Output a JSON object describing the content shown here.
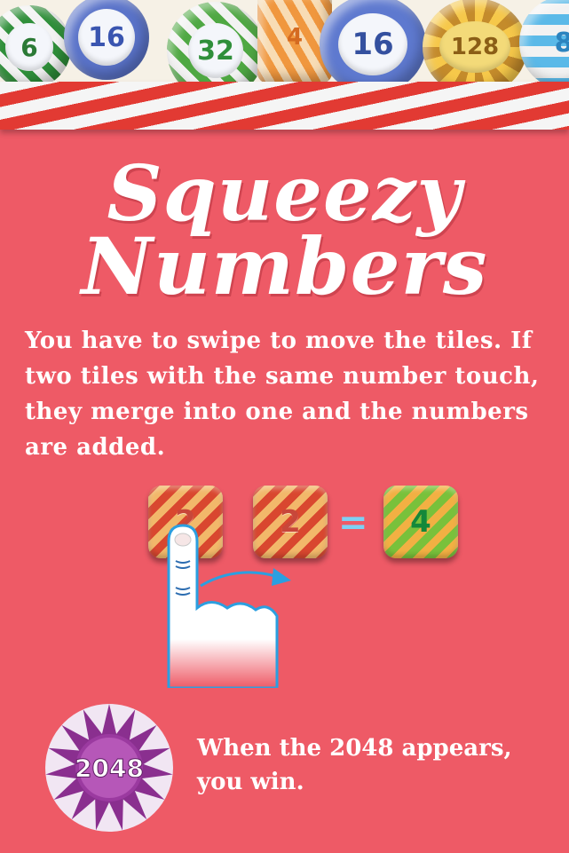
{
  "header_balls": [
    "6",
    "16",
    "32",
    "4",
    "16",
    "128",
    "8"
  ],
  "title": {
    "line1": "Squeezy",
    "line2": "Numbers"
  },
  "instructions": "You have to swipe to move the tiles. If two tiles with the same number touch, they merge into one and the numbers are added.",
  "example": {
    "tile_left": "2",
    "tile_middle": "2",
    "equals": "=",
    "tile_result": "4"
  },
  "win": {
    "badge": "2048",
    "text": "When the 2048 appears, you win."
  },
  "colors": {
    "background": "#ee5a66",
    "text": "#ffffff",
    "arrow": "#2b9fe0"
  }
}
